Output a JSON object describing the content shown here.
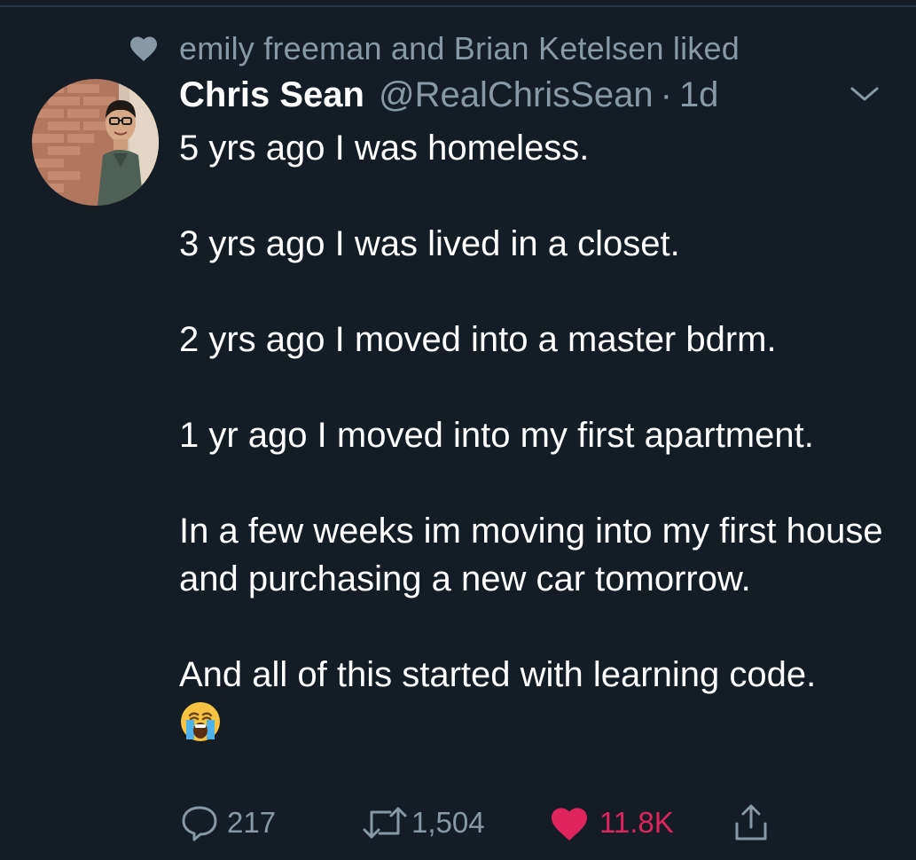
{
  "social_context": {
    "text": "emily freeman and Brian Ketelsen liked"
  },
  "tweet": {
    "display_name": "Chris Sean",
    "handle": "@RealChrisSean",
    "separator": "·",
    "timestamp": "1d",
    "lines": [
      "5 yrs ago I was homeless.",
      "3 yrs ago I was lived in a closet.",
      "2 yrs ago I moved into a master bdrm.",
      "1 yr ago I moved into my first apartment.",
      "In a few weeks im moving into my first house and purchasing a new car tomorrow.",
      "And all of this started with learning code."
    ],
    "emoji": "loudly-crying-face"
  },
  "actions": {
    "replies": "217",
    "retweets": "1,504",
    "likes": "11.8K"
  },
  "colors": {
    "background": "#141d26",
    "muted": "#8899a6",
    "like": "#e0245e",
    "text": "#ffffff"
  }
}
